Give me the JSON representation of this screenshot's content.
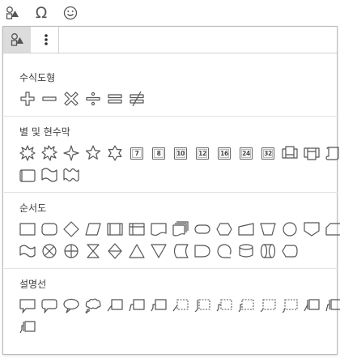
{
  "toolbar": {
    "items": [
      {
        "name": "shapes-icon"
      },
      {
        "name": "omega-symbol-icon",
        "glyph": "Ω"
      },
      {
        "name": "smiley-icon"
      }
    ]
  },
  "panel": {
    "tabs": [
      {
        "name": "shapes-tab-icon"
      },
      {
        "name": "more-vertical-icon"
      }
    ],
    "sections": [
      {
        "title": "수식도형",
        "shapes": [
          "plus",
          "minus",
          "multiply",
          "divide",
          "equal",
          "not-equal"
        ]
      },
      {
        "title": "별 및 현수막",
        "shapes": [
          "explosion-1",
          "explosion-2",
          "star-4",
          "star-5",
          "star-6",
          "star-7",
          "star-8",
          "star-10",
          "star-12",
          "star-16",
          "star-24",
          "star-32",
          "ribbon-up",
          "ribbon-down",
          "scroll-vertical",
          "scroll-horizontal",
          "wave",
          "double-wave"
        ],
        "numbers": {
          "star-7": "7",
          "star-8": "8",
          "star-10": "10",
          "star-12": "12",
          "star-16": "16",
          "star-24": "24",
          "star-32": "32"
        }
      },
      {
        "title": "순서도",
        "shapes": [
          "process",
          "alternate-process",
          "decision",
          "data",
          "predefined-process",
          "internal-storage",
          "document",
          "multidocument",
          "terminator",
          "preparation",
          "manual-input",
          "manual-operation",
          "connector",
          "offpage-connector",
          "card",
          "punched-tape",
          "summing-junction",
          "or",
          "collate",
          "sort",
          "extract",
          "merge",
          "stored-data",
          "delay",
          "sequential-access",
          "magnetic-disk",
          "direct-access",
          "display"
        ]
      },
      {
        "title": "설명선",
        "shapes": [
          "rect-callout",
          "rounded-callout",
          "oval-callout",
          "cloud-callout",
          "line-callout-1",
          "line-callout-2",
          "line-callout-3",
          "line-callout-1-dashed",
          "line-callout-2-dashed",
          "line-callout-3-dashed",
          "line-callout-4-dashed",
          "line-callout-5-dashed",
          "line-callout-6-dashed",
          "line-callout-accent",
          "line-callout-border",
          "line-callout-border-2"
        ]
      }
    ]
  },
  "colors": {
    "icon": "#555555",
    "accent": "#e06a4a",
    "divider": "#e2e2e2"
  }
}
